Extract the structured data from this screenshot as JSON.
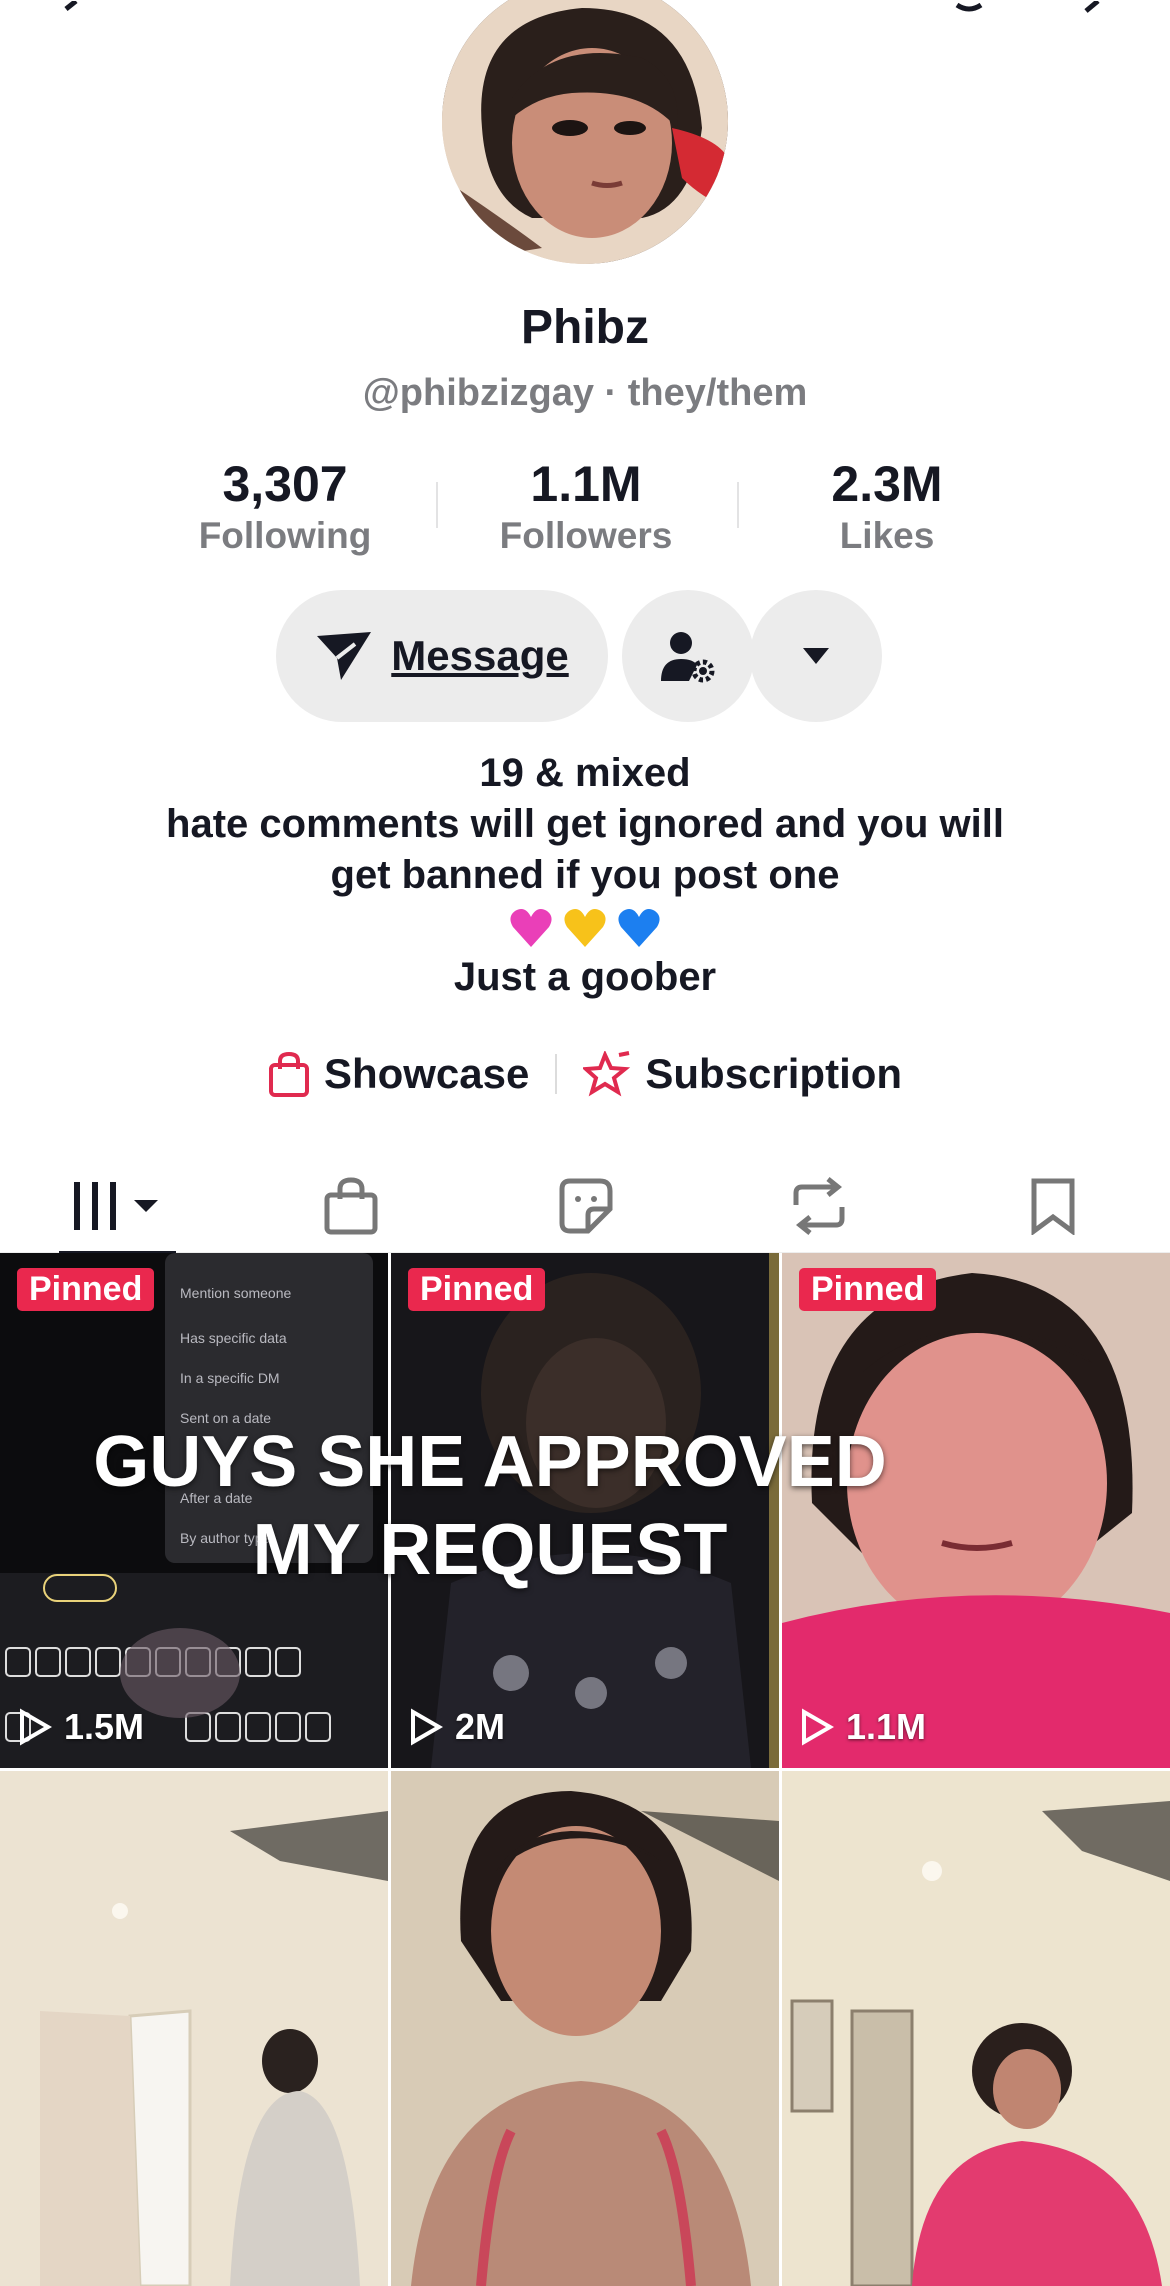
{
  "profile": {
    "display_name": "Phibz",
    "handle_line": "@phibzizgay · they/them"
  },
  "stats": [
    {
      "value": "3,307",
      "label": "Following"
    },
    {
      "value": "1.1M",
      "label": "Followers"
    },
    {
      "value": "2.3M",
      "label": "Likes"
    }
  ],
  "actions": {
    "message_label": "Message"
  },
  "bio": {
    "line1": "19 & mixed",
    "line2": "hate comments will get ignored and you will",
    "line3": "get banned if you post one",
    "emojis": [
      "pink-heart",
      "yellow-heart",
      "blue-heart"
    ],
    "line5": "Just a goober"
  },
  "links": {
    "showcase": "Showcase",
    "subscription": "Subscription"
  },
  "tabs": [
    "videos-tab",
    "shop-tab",
    "stickers-tab",
    "reposts-tab",
    "favorites-tab"
  ],
  "videos": [
    {
      "pinned": "Pinned",
      "views": "1.5M"
    },
    {
      "pinned": "Pinned",
      "views": "2M"
    },
    {
      "pinned": "Pinned",
      "views": "1.1M"
    },
    {
      "pinned": "",
      "views": ""
    },
    {
      "pinned": "",
      "views": ""
    },
    {
      "pinned": "",
      "views": ""
    }
  ],
  "video_overlay": {
    "line1": "GUYS SHE APPROVED",
    "line2": "MY REQUEST"
  },
  "colors": {
    "pinned_badge": "#ea284e",
    "shop_icon": "#e02a4f",
    "button_bg": "#ececec"
  }
}
